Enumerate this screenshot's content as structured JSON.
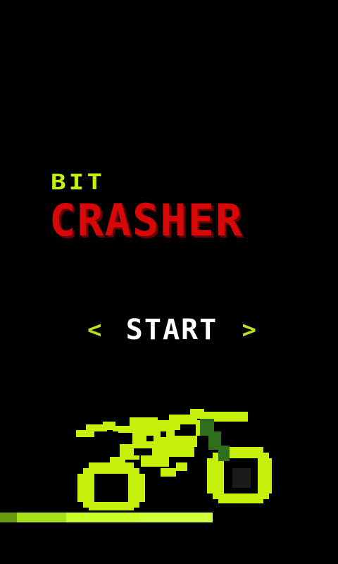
{
  "title": {
    "small": "BIT",
    "big": "CRASHER"
  },
  "menu": {
    "start_label": "START",
    "left_arrow": "<",
    "right_arrow": ">"
  },
  "colors": {
    "background": "#000000",
    "accent_green": "#c4f00a",
    "title_red": "#d80808",
    "start_white": "#ffffff",
    "bike_dark_green": "#2e6e1c"
  },
  "icons": {
    "bike": "motorbike-icon"
  }
}
